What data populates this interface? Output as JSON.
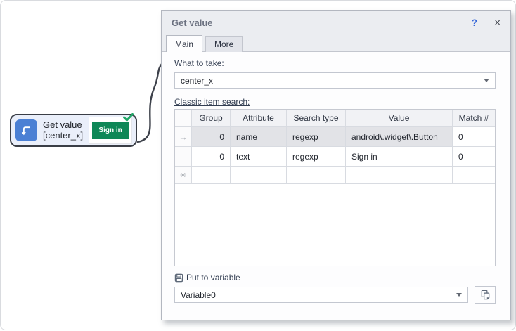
{
  "node": {
    "title": "Get value",
    "subtitle": "[center_x]",
    "preview_button_label": "Sign in"
  },
  "dialog": {
    "title": "Get value",
    "help_glyph": "?",
    "close_glyph": "×",
    "tabs": [
      {
        "label": "Main"
      },
      {
        "label": "More"
      }
    ],
    "what_to_take": {
      "label": "What to take:",
      "value": "center_x"
    },
    "search": {
      "label": "Classic item search:",
      "columns": [
        "Group",
        "Attribute",
        "Search type",
        "Value",
        "Match #"
      ],
      "rows": [
        {
          "indicator": "→",
          "group": "0",
          "attribute": "name",
          "search_type": "regexp",
          "value": "android\\.widget\\.Button",
          "match": "0"
        },
        {
          "indicator": "",
          "group": "0",
          "attribute": "text",
          "search_type": "regexp",
          "value": "Sign in",
          "match": "0"
        },
        {
          "indicator": "✳",
          "group": "",
          "attribute": "",
          "search_type": "",
          "value": "",
          "match": ""
        }
      ]
    },
    "put_to_variable": {
      "label": "Put to variable",
      "value": "Variable0"
    }
  },
  "colors": {
    "accent_blue": "#4b80d4",
    "button_green": "#0e8757",
    "check_green": "#21a667",
    "header_bg": "#ebedf1",
    "selected_row_bg": "#e2e3e7",
    "help_blue": "#3566d8"
  }
}
